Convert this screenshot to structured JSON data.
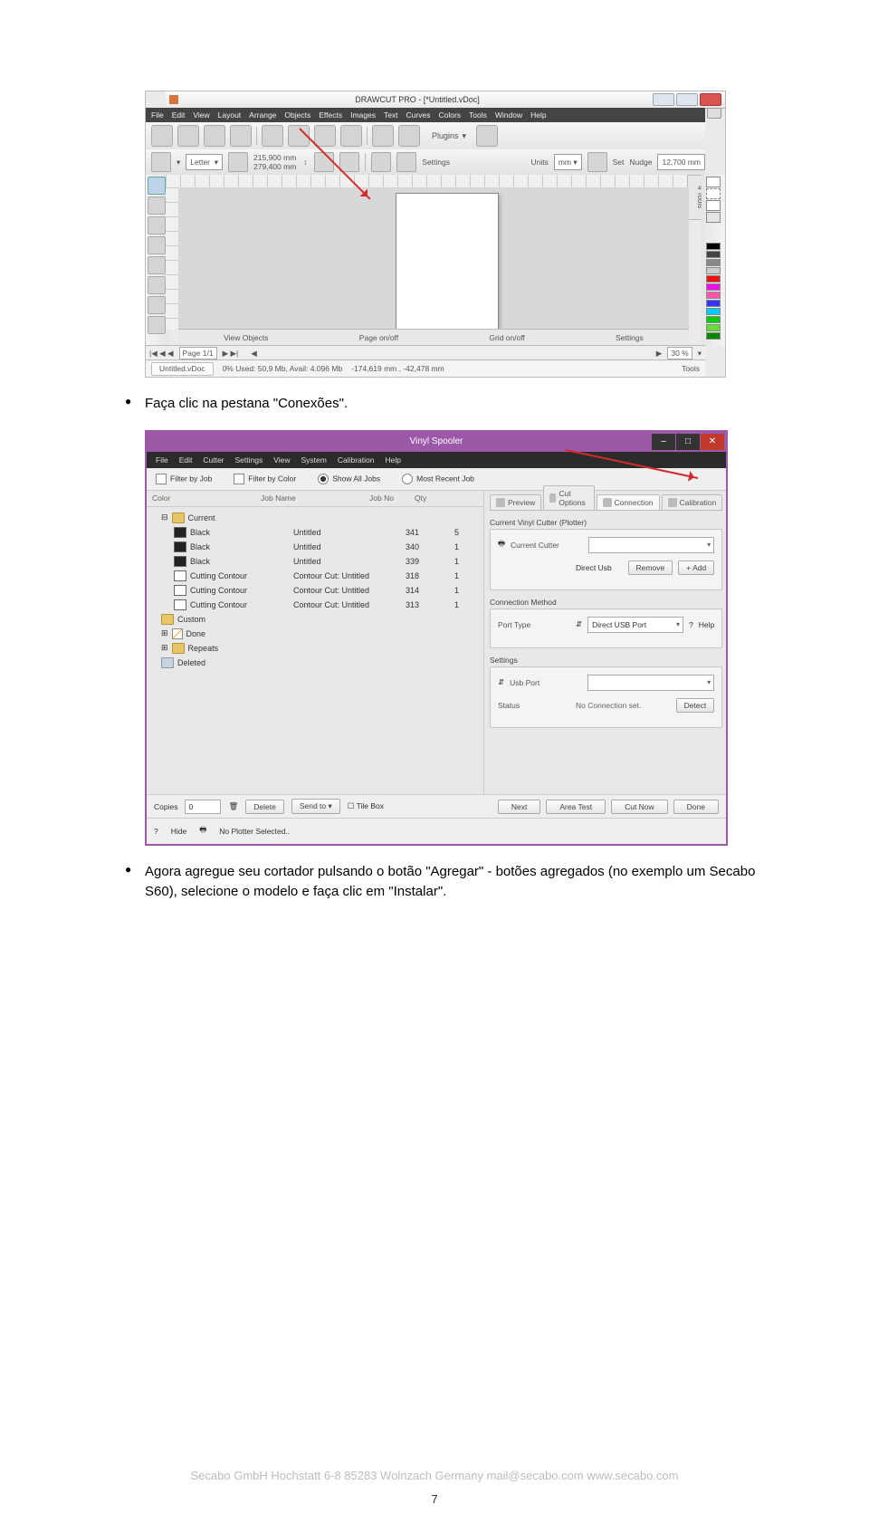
{
  "bullets": {
    "b1": "Faça clic na pestana \"Conexões\".",
    "b2": "Agora agregue seu cortador pulsando o botão \"Agregar\" - botões agregados (no exemplo um Secabo S60), selecione o modelo e faça clic em \"Instalar\"."
  },
  "drawcut": {
    "title": "DRAWCUT PRO - [*Untitled.vDoc]",
    "menu": [
      "File",
      "Edit",
      "View",
      "Layout",
      "Arrange",
      "Objects",
      "Effects",
      "Images",
      "Text",
      "Curves",
      "Colors",
      "Tools",
      "Window",
      "Help"
    ],
    "plugins_label": "Plugins",
    "opt": {
      "letter": "Letter",
      "dim_w": "215,900 mm",
      "dim_h": "279,400 mm",
      "settings": "Settings",
      "units_lbl": "Units",
      "units": "mm",
      "set": "Set",
      "nudge_lbl": "Nudge",
      "nudge": "12,700 mm"
    },
    "right_tab": "4 Tools",
    "below": {
      "view": "View Objects",
      "page": "Page on/off",
      "grid": "Grid on/off",
      "settings": "Settings"
    },
    "pageband": {
      "page": "Page 1/1",
      "zoom": "30 %"
    },
    "status": {
      "doc": "Untitled.vDoc",
      "mem": "0%  Used: 50,9 Mb, Avail: 4.096 Mb",
      "coord": "-174,619 mm , -42,478 mm",
      "tools": "Tools"
    }
  },
  "spooler": {
    "title": "Vinyl Spooler",
    "menu": [
      "File",
      "Edit",
      "Cutter",
      "Settings",
      "View",
      "System",
      "Calibration",
      "Help"
    ],
    "filter": {
      "job": "Filter by Job",
      "color": "Filter by Color",
      "all": "Show All Jobs",
      "recent": "Most Recent Job"
    },
    "cols": {
      "color": "Color",
      "name": "Job Name",
      "no": "Job No",
      "qty": "Qty"
    },
    "tree": {
      "current": "Current",
      "rows": [
        {
          "sq": "black",
          "name": "Black",
          "job": "Untitled",
          "no": "341",
          "qty": "5"
        },
        {
          "sq": "black",
          "name": "Black",
          "job": "Untitled",
          "no": "340",
          "qty": "1"
        },
        {
          "sq": "black",
          "name": "Black",
          "job": "Untitled",
          "no": "339",
          "qty": "1"
        },
        {
          "sq": "cut",
          "name": "Cutting Contour",
          "job": "Contour Cut: Untitled",
          "no": "318",
          "qty": "1"
        },
        {
          "sq": "cut",
          "name": "Cutting Contour",
          "job": "Contour Cut: Untitled",
          "no": "314",
          "qty": "1"
        },
        {
          "sq": "cut",
          "name": "Cutting Contour",
          "job": "Contour Cut: Untitled",
          "no": "313",
          "qty": "1"
        }
      ],
      "custom": "Custom",
      "done": "Done",
      "repeats": "Repeats",
      "deleted": "Deleted"
    },
    "tabs": {
      "preview": "Preview",
      "cut": "Cut Options",
      "conn": "Connection",
      "cal": "Calibration"
    },
    "cutter": {
      "grp": "Current Vinyl Cutter (Plotter)",
      "lbl": "Current Cutter",
      "direct": "Direct Usb",
      "remove": "Remove",
      "add": "Add"
    },
    "method": {
      "grp": "Connection Method",
      "port_lbl": "Port Type",
      "port": "Direct USB Port",
      "help": "Help"
    },
    "settings": {
      "grp": "Settings",
      "usb_lbl": "Usb Port",
      "status_lbl": "Status",
      "status": "No Connection set.",
      "detect": "Detect"
    },
    "bottom_left": {
      "copies": "Copies",
      "copies_n": "0",
      "delete": "Delete",
      "send": "Send to",
      "tile": "Tile Box"
    },
    "bottom_right": {
      "next": "Next",
      "area": "Area Test",
      "cut": "Cut Now",
      "done": "Done"
    },
    "footer": {
      "hide": "Hide",
      "plotter": "No Plotter Selected.."
    }
  },
  "footer": "Secabo GmbH   Hochstatt 6-8   85283 Wolnzach   Germany   mail@secabo.com   www.secabo.com",
  "page_num": "7"
}
